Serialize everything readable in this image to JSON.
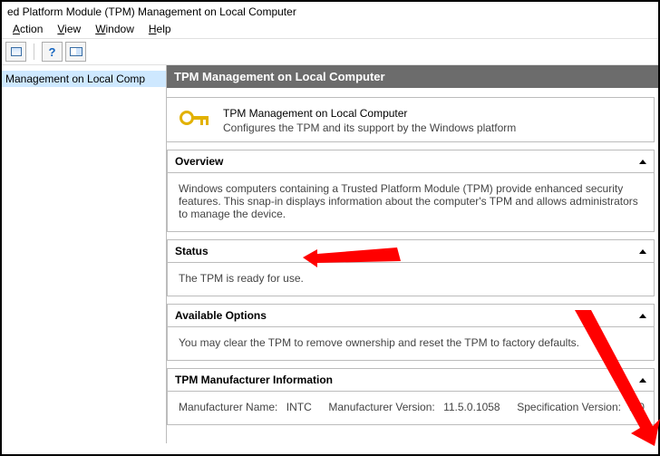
{
  "window": {
    "title": "ed Platform Module (TPM) Management on Local Computer"
  },
  "menu": {
    "action": "Action",
    "view": "View",
    "window": "Window",
    "help": "Help"
  },
  "tree": {
    "item": "Management on Local Comp"
  },
  "header": {
    "text": "TPM Management on Local Computer"
  },
  "hero": {
    "title": "TPM Management on Local Computer",
    "desc": "Configures the TPM and its support by the Windows platform"
  },
  "overview": {
    "heading": "Overview",
    "body": "Windows computers containing a Trusted Platform Module (TPM) provide enhanced security features. This snap-in displays information about the computer's TPM and allows administrators to manage the device."
  },
  "status": {
    "heading": "Status",
    "body": "The TPM is ready for use."
  },
  "options": {
    "heading": "Available Options",
    "body": "You may clear the TPM to remove ownership and reset the TPM to factory defaults."
  },
  "mfr": {
    "heading": "TPM Manufacturer Information",
    "name_label": "Manufacturer Name:",
    "name_value": "INTC",
    "version_label": "Manufacturer Version:",
    "version_value": "11.5.0.1058",
    "spec_label": "Specification Version:",
    "spec_value": "2.0"
  }
}
